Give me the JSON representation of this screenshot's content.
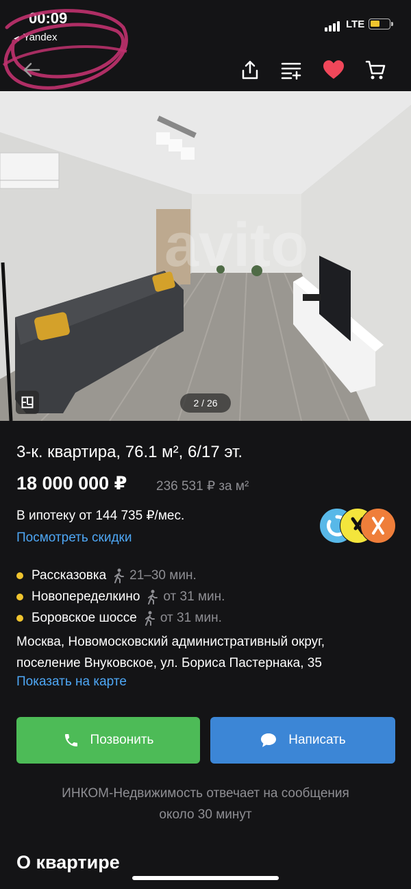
{
  "status_bar": {
    "time": "00:09",
    "back_app": "Yandex",
    "network": "LTE"
  },
  "toolbar": {
    "icons": [
      "back-arrow-icon",
      "share-icon",
      "compare-icon",
      "heart-icon",
      "cart-icon"
    ],
    "favorite_color": "#f0475a"
  },
  "photo": {
    "counter": "2 / 26",
    "watermark": "avito"
  },
  "listing": {
    "title": "3-к. квартира, 76.1 м², 6/17 эт.",
    "price": "18 000 000 ₽",
    "price_per_m": "236 531 ₽ за м²",
    "mortgage": "В ипотеку от 144 735 ₽/мес.",
    "discounts_link": "Посмотреть скидки"
  },
  "metro": [
    {
      "name": "Рассказовка",
      "time": "21–30 мин."
    },
    {
      "name": "Новопеределкино",
      "time": "от 31 мин."
    },
    {
      "name": "Боровское шоссе",
      "time": "от 31 мин."
    }
  ],
  "address": {
    "line1": "Москва, Новомосковский административный округ,",
    "line2": "поселение Внуковское, ул. Бориса Пастернака, 35",
    "map_link": "Показать на карте"
  },
  "actions": {
    "call": "Позвонить",
    "message": "Написать"
  },
  "seller_reply": {
    "line1": "ИНКОМ-Недвижимость отвечает на сообщения",
    "line2": "около 30 минут"
  },
  "section_title": "О квартире",
  "colors": {
    "background": "#141416",
    "link": "#4ea7f5",
    "call_button": "#4dbb57",
    "message_button": "#3c86d6",
    "metro_dot": "#f0c42e"
  }
}
